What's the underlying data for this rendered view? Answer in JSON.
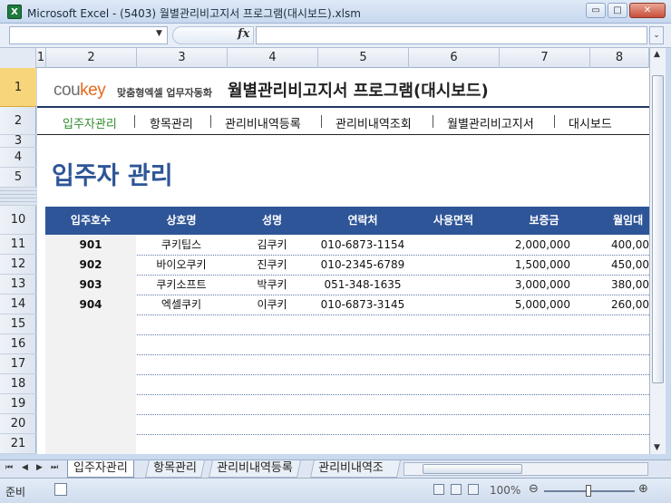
{
  "window": {
    "title": "Microsoft Excel - (5403) 월별관리비고지서 프로그램(대시보드).xlsm",
    "app_icon": "X",
    "minimize": "▭",
    "restore": "□",
    "close": "✕"
  },
  "formula_bar": {
    "name_box": "",
    "fx": "fx",
    "formula": ""
  },
  "columns": [
    "1",
    "2",
    "3",
    "4",
    "5",
    "6",
    "7",
    "8"
  ],
  "rows": [
    "1",
    "2",
    "3",
    "4",
    "5",
    "10",
    "11",
    "12",
    "13",
    "14",
    "15",
    "16",
    "17",
    "18",
    "19",
    "20",
    "21"
  ],
  "brand": {
    "logo_co": "cou",
    "logo_key": "key",
    "tagline": "맞춤형엑셀 업무자동화"
  },
  "app_title": "월별관리비고지서 프로그램(대시보드)",
  "nav": [
    "입주자관리",
    "항목관리",
    "관리비내역등록",
    "관리비내역조회",
    "월별관리비고지서",
    "대시보드"
  ],
  "page_title": "입주자 관리",
  "table": {
    "headers": [
      "입주호수",
      "상호명",
      "성명",
      "연락처",
      "사용면적",
      "보증금",
      "월임대"
    ],
    "rows": [
      [
        "901",
        "쿠키팁스",
        "김쿠키",
        "010-6873-1154",
        "",
        "2,000,000",
        "400,00"
      ],
      [
        "902",
        "바이오쿠키",
        "진쿠키",
        "010-2345-6789",
        "",
        "1,500,000",
        "450,00"
      ],
      [
        "903",
        "쿠키소프트",
        "박쿠키",
        "051-348-1635",
        "",
        "3,000,000",
        "380,00"
      ],
      [
        "904",
        "엑셀쿠키",
        "이쿠키",
        "010-6873-3145",
        "",
        "5,000,000",
        "260,00"
      ]
    ]
  },
  "sheet_tabs": [
    "입주자관리",
    "항목관리",
    "관리비내역등록",
    "관리비내역조"
  ],
  "status": {
    "mode": "준비",
    "zoom": "100%"
  },
  "colors": {
    "accent": "#2e5597",
    "active_nav": "#2e8b2e",
    "brand_key": "#e66a1f"
  }
}
